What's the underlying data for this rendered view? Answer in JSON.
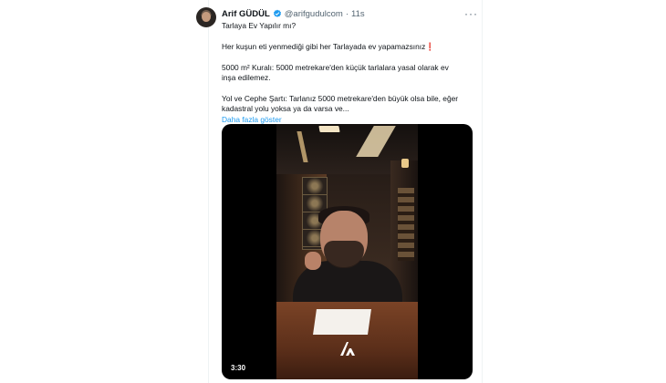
{
  "tweet": {
    "author_name": "Arif GÜDÜL",
    "handle": "@arifgudulcom",
    "separator": "·",
    "time": "11s",
    "more_label": "···",
    "paragraphs": [
      "Tarlaya Ev Yapılır mı?",
      "Her kuşun eti yenmediği gibi her Tarlayada ev yapamazsınız❗",
      "5000 m² Kuralı: 5000 metrekare'den küçük tarlalara yasal olarak ev inşa edilemez.",
      "Yol ve Cephe Şartı: Tarlanız 5000 metrekare'den büyük olsa bile, eğer kadastral yolu yoksa ya da varsa ve..."
    ],
    "show_more": "Daha fazla göster",
    "verified_color": "#1d9bf0",
    "link_color": "#1d9bf0"
  },
  "video": {
    "duration": "3:30",
    "icons": [
      "avatar",
      "verified-badge-icon",
      "more-options-icon",
      "video-logo-icon"
    ]
  }
}
